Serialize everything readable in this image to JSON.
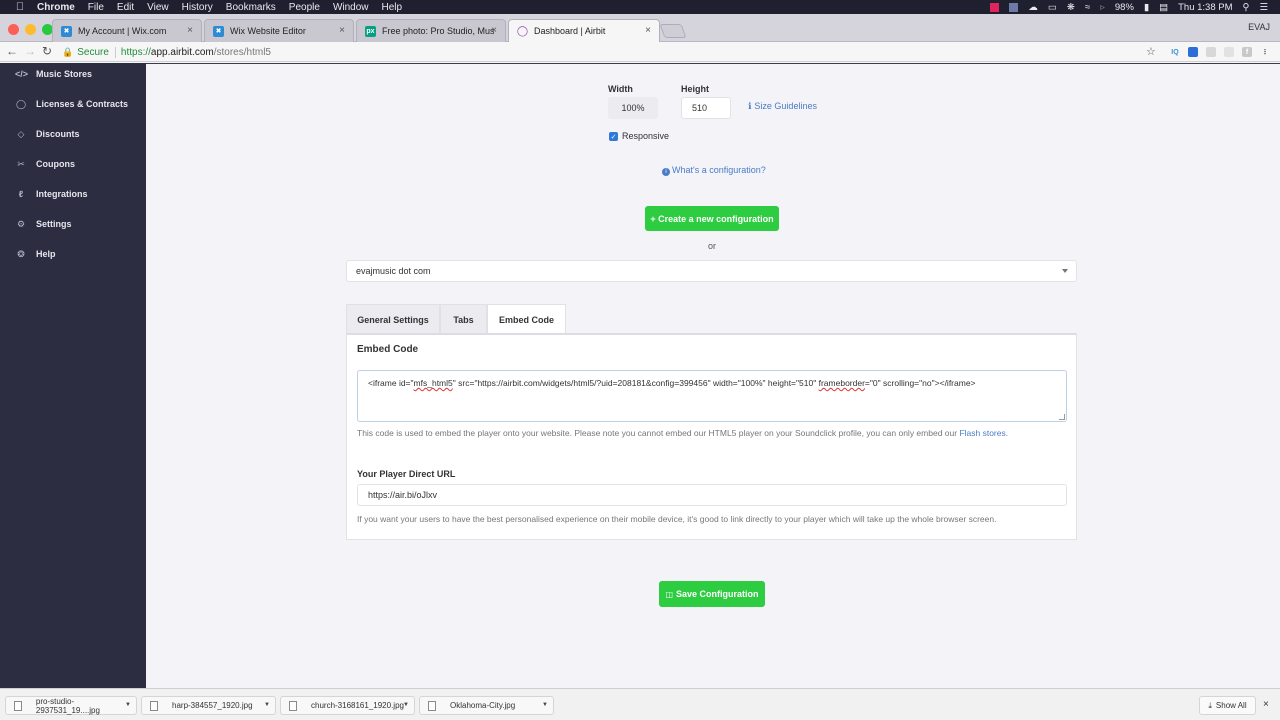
{
  "menubar": {
    "app": "Chrome",
    "items": [
      "File",
      "Edit",
      "View",
      "History",
      "Bookmarks",
      "People",
      "Window",
      "Help"
    ],
    "battery": "98%",
    "clock": "Thu 1:38 PM"
  },
  "browser": {
    "tabs": [
      {
        "title": "My Account | Wix.com",
        "favicon": "wix-icon"
      },
      {
        "title": "Wix Website Editor",
        "favicon": "wix-icon"
      },
      {
        "title": "Free photo: Pro Studio, Music",
        "favicon": "pexels-icon"
      },
      {
        "title": "Dashboard | Airbit",
        "favicon": "airbit-icon",
        "active": true
      }
    ],
    "profile": "EVAJ",
    "address": {
      "secure_label": "Secure",
      "scheme": "https://",
      "host": "app.airbit.com",
      "path": "/stores/html5"
    }
  },
  "sidebar": {
    "items": [
      {
        "label": "Music Stores",
        "icon": "</>"
      },
      {
        "label": "Licenses & Contracts",
        "icon": "shield"
      },
      {
        "label": "Discounts",
        "icon": "tag"
      },
      {
        "label": "Coupons",
        "icon": "scissors"
      },
      {
        "label": "Integrations",
        "icon": "plug"
      },
      {
        "label": "Settings",
        "icon": "gear"
      },
      {
        "label": "Help",
        "icon": "lifebuoy"
      }
    ]
  },
  "form": {
    "width_label": "Width",
    "width_value": "100%",
    "height_label": "Height",
    "height_value": "510",
    "size_guidelines": "Size Guidelines",
    "responsive_label": "Responsive",
    "responsive_checked": true,
    "whats_config": "What's a configuration?",
    "create_button": "+ Create a new configuration",
    "or_text": "or",
    "config_selected": "evajmusic dot com"
  },
  "config_tabs": [
    "General Settings",
    "Tabs",
    "Embed Code"
  ],
  "active_tab": "Embed Code",
  "embed": {
    "heading": "Embed Code",
    "code_prefix": "<iframe id=\"",
    "code_id": "mfs_html5",
    "code_mid": "\" src=\"https://airbit.com/widgets/html5/?uid=208181&config=399456\" width=\"100%\" height=\"510\" ",
    "code_fb": "frameborder",
    "code_suffix": "=\"0\" scrolling=\"no\"></iframe>",
    "help_text": "This code is used to embed the player onto your website. Please note you cannot embed our HTML5 player on your Soundclick profile, you can only embed our ",
    "help_link": "Flash stores",
    "help_end": ".",
    "direct_url_label": "Your Player Direct URL",
    "direct_url": "https://air.bi/oJlxv",
    "direct_help": "If you want your users to have the best personalised experience on their mobile device, it's good to link directly to your player which will take up the whole browser screen."
  },
  "save_button": "Save Configuration",
  "downloads": {
    "items": [
      "pro-studio-2937531_19....jpg",
      "harp-384557_1920.jpg",
      "church-3168161_1920.jpg",
      "Oklahoma-City.jpg"
    ],
    "show_all": "Show All"
  },
  "colors": {
    "sidebar_bg": "#2c2d40",
    "accent_green": "#2ecc40",
    "link_blue": "#4a7cc7",
    "page_bg": "#f3f3f8"
  }
}
